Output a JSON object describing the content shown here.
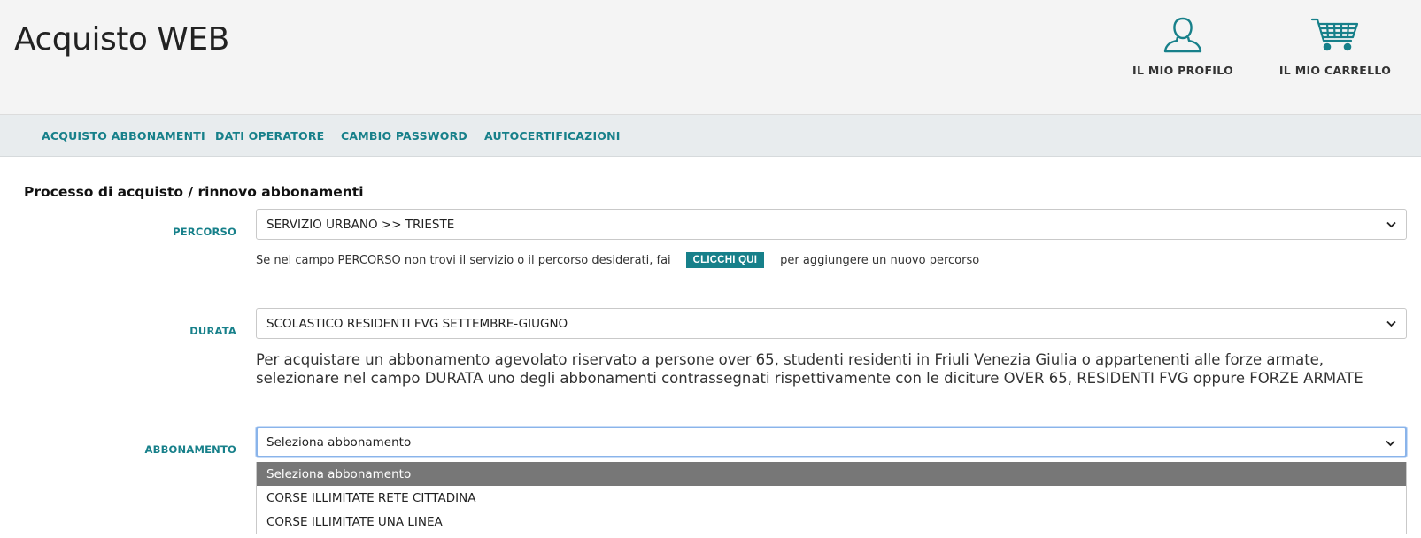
{
  "header": {
    "title": "Acquisto WEB",
    "profile_label": "IL MIO PROFILO",
    "cart_label": "IL MIO CARRELLO"
  },
  "nav": {
    "items": [
      {
        "label": "ACQUISTO ABBONAMENTI"
      },
      {
        "label": "DATI OPERATORE"
      },
      {
        "label": "CAMBIO PASSWORD"
      },
      {
        "label": "AUTOCERTIFICAZIONI"
      }
    ]
  },
  "main": {
    "section_title": "Processo di acquisto / rinnovo abbonamenti",
    "percorso": {
      "label": "PERCORSO",
      "value": "SERVIZIO URBANO >> TRIESTE",
      "hint_before": "Se nel campo PERCORSO non trovi il servizio o il percorso desiderati, fai",
      "hint_button": "CLICCHI QUI",
      "hint_after": "per aggiungere un nuovo percorso"
    },
    "durata": {
      "label": "DURATA",
      "value": "SCOLASTICO RESIDENTI FVG SETTEMBRE-GIUGNO",
      "info": "Per acquistare un abbonamento agevolato riservato a persone over 65, studenti residenti in Friuli Venezia Giulia o appartenenti alle forze armate, selezionare nel campo DURATA uno degli abbonamenti contrassegnati rispettivamente con le diciture OVER 65, RESIDENTI FVG oppure FORZE ARMATE"
    },
    "abbonamento": {
      "label": "ABBONAMENTO",
      "value": "Seleziona abbonamento",
      "options": [
        {
          "label": "Seleziona abbonamento"
        },
        {
          "label": "CORSE ILLIMITATE RETE CITTADINA"
        },
        {
          "label": "CORSE ILLIMITATE UNA LINEA"
        }
      ]
    }
  },
  "colors": {
    "accent": "#17808a",
    "header_bg": "#f4f4f4",
    "nav_bg": "#e8ecee",
    "option_selected_bg": "#777777",
    "focus_border": "#8ab4ea"
  },
  "icons": {
    "profile": "user-icon",
    "cart": "shopping-cart-icon",
    "select_arrow": "chevron-down-icon"
  }
}
